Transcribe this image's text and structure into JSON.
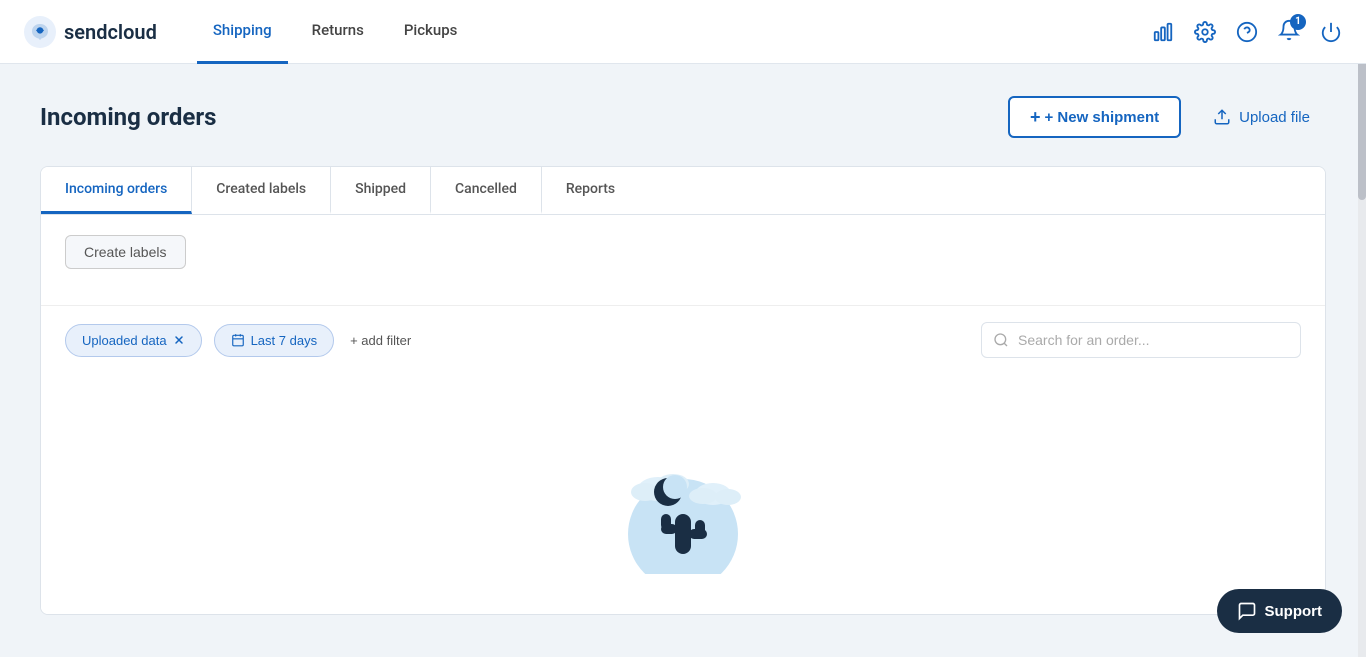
{
  "app": {
    "name": "sendcloud"
  },
  "navbar": {
    "logo_alt": "sendcloud logo",
    "links": [
      {
        "label": "Shipping",
        "active": true
      },
      {
        "label": "Returns",
        "active": false
      },
      {
        "label": "Pickups",
        "active": false
      }
    ],
    "icons": [
      "chart-icon",
      "gear-icon",
      "help-icon",
      "bell-icon",
      "power-icon"
    ],
    "notification_count": "1"
  },
  "page": {
    "title": "Incoming orders",
    "actions": {
      "new_shipment_label": "+ New shipment",
      "upload_file_label": "Upload file"
    }
  },
  "tabs": [
    {
      "label": "Incoming orders",
      "active": true
    },
    {
      "label": "Created labels",
      "active": false
    },
    {
      "label": "Shipped",
      "active": false
    },
    {
      "label": "Cancelled",
      "active": false
    },
    {
      "label": "Reports",
      "active": false
    }
  ],
  "tab_content": {
    "create_labels_btn": "Create labels",
    "filters": {
      "uploaded_data": "Uploaded data",
      "date_range": "Last 7 days",
      "add_filter": "+ add filter"
    },
    "search": {
      "placeholder": "Search for an order..."
    }
  },
  "support": {
    "label": "Support"
  }
}
